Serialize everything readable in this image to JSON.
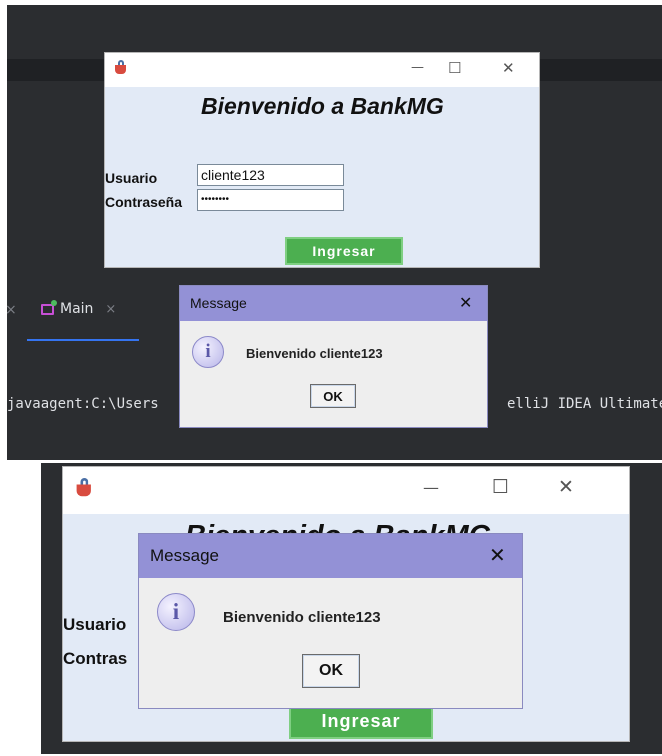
{
  "ide": {
    "tab_label": "Main",
    "tab_close": "×",
    "left_tab_close": "×",
    "console_left": "javaagent:C:\\Users",
    "console_right": "elliJ IDEA Ultimate"
  },
  "login_window": {
    "icon": "java-app-icon",
    "minimize": "—",
    "maximize": "☐",
    "close": "✕",
    "headline": "Bienvenido a BankMG",
    "user_label": "Usuario",
    "user_value": "cliente123",
    "password_label": "Contraseña",
    "password_value": "••••••••",
    "submit_label": "Ingresar",
    "user_label_cut": "Usuario",
    "password_label_cut": "Contras",
    "headline_right_fragment": "MG"
  },
  "message_dialog": {
    "title": "Message",
    "close": "✕",
    "icon": "info-icon",
    "icon_glyph": "i",
    "text": "Bienvenido cliente123",
    "ok_label": "OK"
  },
  "colors": {
    "ide_bg": "#2b2d30",
    "frame_bg": "#e2eaf6",
    "dialog_title": "#9391d6",
    "button_green": "#4caf50"
  }
}
